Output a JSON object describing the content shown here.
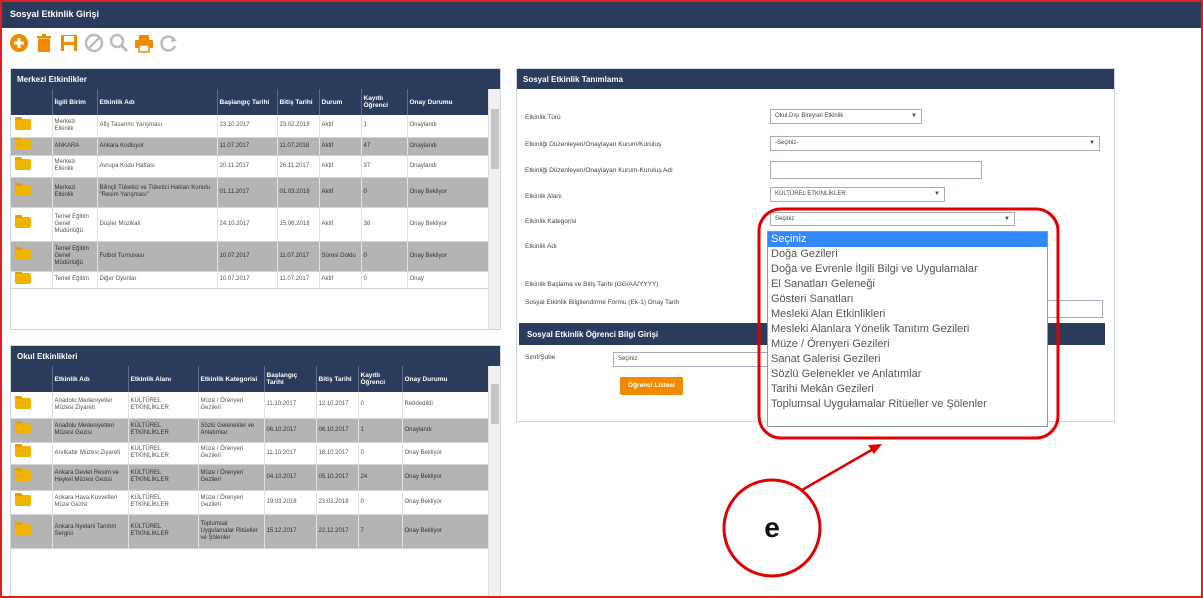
{
  "window_title": "Sosyal Etkinlik Girişi",
  "toolbar": {
    "icons": [
      "add-icon",
      "delete-icon",
      "save-icon",
      "cancel-icon",
      "search-icon",
      "print-icon",
      "refresh-icon"
    ]
  },
  "merkezi": {
    "title": "Merkezi Etkinlikler",
    "columns": [
      "",
      "İlgili Birim",
      "Etkinlik Adı",
      "Başlangıç Tarihi",
      "Bitiş Tarihi",
      "Durum",
      "Kayıtlı Öğrenci",
      "Onay Durumu"
    ],
    "rows": [
      [
        "Merkezi Etkinlik",
        "Afiş Tasarımı Yarışması",
        "23.10.2017",
        "23.02.2018",
        "Aktif",
        "1",
        "Onaylandı"
      ],
      [
        "ANKARA",
        "Ankara Kodluyor",
        "11.07.2017",
        "11.07.2018",
        "Aktif",
        "47",
        "Onaylandı"
      ],
      [
        "Merkezi Etkinlik",
        "Avrupa Kodu Haftası",
        "20.11.2017",
        "26.11.2017",
        "Aktif",
        "37",
        "Onaylandı"
      ],
      [
        "Merkezi Etkinlik",
        "Bilinçli Tüketici ve Tüketici Hakları Konulu \"Resim Yarışması\"",
        "01.11.2017",
        "01.03.2018",
        "Aktif",
        "0",
        "Onay Bekliyor"
      ],
      [
        "Temel Eğitim Genel Müdürlüğü",
        "Düşler Müzikali",
        "24.10.2017",
        "15.06.2018",
        "Aktif",
        "38",
        "Onay Bekliyor"
      ],
      [
        "Temel Eğitim Genel Müdürlüğü",
        "Futbol Turnuvası",
        "10.07.2017",
        "11.07.2017",
        "Süresi Doldu",
        "0",
        "Onay Bekliyor"
      ],
      [
        "Temel Eğitim",
        "Diğer Oyunlar",
        "10.07.2017",
        "11.07.2017",
        "Aktif",
        "0",
        "Onay"
      ]
    ]
  },
  "okul": {
    "title": "Okul Etkinlikleri",
    "columns": [
      "",
      "Etkinlik Adı",
      "Etkinlik Alanı",
      "Etkinlik Kategorisi",
      "Başlangıç Tarihi",
      "Bitiş Tarihi",
      "Kayıtlı Öğrenci",
      "Onay Durumu"
    ],
    "rows": [
      [
        "Anadolu Medeniyetler Müzesi Ziyareti",
        "KÜLTÜREL ETKİNLİKLER",
        "Müze / Örenyeri Gezileri",
        "11.10.2017",
        "12.10.2017",
        "0",
        "Reddedildi"
      ],
      [
        "Anadolu Medeniyetleri Müzesi Gezisi",
        "KÜLTÜREL ETKİNLİKLER",
        "Sözlü Gelenekler ve Anlatımlar",
        "06.10.2017",
        "06.10.2017",
        "1",
        "Onaylandı"
      ],
      [
        "Anıtkabir Müzesi Ziyareti",
        "KÜLTÜREL ETKİNLİKLER",
        "Müze / Örenyeri Gezileri",
        "11.10.2017",
        "18.10.2017",
        "0",
        "Onay Bekliyor"
      ],
      [
        "Ankara Devlet Resim ve Heykel Müzesi Gezisi",
        "KÜLTÜREL ETKİNLİKLER",
        "Müze / Örenyeri Gezileri",
        "04.10.2017",
        "05.10.2017",
        "24",
        "Onay Bekliyor"
      ],
      [
        "Ankara Hava Kuvvetleri Müze Gezisi",
        "KÜLTÜREL ETKİNLİKLER",
        "Müze / Örenyeri Gezileri",
        "19.03.2018",
        "23.03.2018",
        "0",
        "Onay Bekliyor"
      ],
      [
        "Ankara Nyelani Tanıtım Sergisi",
        "KÜLTÜREL ETKİNLİKLER",
        "Toplumsal Uygulamalar Ritüeller ve Şölenler",
        "15.12.2017",
        "22.12.2017",
        "7",
        "Onay Bekliyor"
      ]
    ]
  },
  "form": {
    "title": "Sosyal Etkinlik Tanımlama",
    "etkinlik_turu_label": "Etkinlik Türü",
    "etkinlik_turu_value": "Okul Dışı Bireysel Etkinlik",
    "kurum_label": "Etkinliği Düzenleyen/Onaylayan Kurum/Kuruluş",
    "kurum_value": "-Seçiniz-",
    "kurum_adi_label": "Etkinliği Düzenleyen/Onaylayan Kurum-Kuruluş Adı",
    "kurum_adi_value": "",
    "alan_label": "Etkinlik Alanı",
    "alan_value": "KÜLTÜREL ETKİNLİKLER",
    "kategori_label": "Etkinlik Kategorisi",
    "kategori_value": "Seçiniz",
    "ad_label": "Etkinlik Adı",
    "tarih_label": "Etkinlik Başlama ve Bitiş Tarihi (GG/AA/YYYY)",
    "form_label": "Sosyal Etkinlik Bilgilendirme Formu (Ek-1) Onay Tarih",
    "ogrenci_title": "Sosyal Etkinlik Öğrenci Bilgi Girişi",
    "sube_label": "Sınıf/Şube",
    "sube_value": "Seçiniz",
    "ogrenci_button": "Öğrenci Listesi"
  },
  "dropdown": {
    "selected": "Seçiniz",
    "options": [
      "Seçiniz",
      "Doğa Gezileri",
      "Doğa ve Evrenle İlgili Bilgi ve Uygulamalar",
      "El Sanatları Geleneği",
      "Gösteri Sanatları",
      "Mesleki Alan Etkinlikleri",
      "Mesleki Alanlara Yönelik Tanıtım Gezileri",
      "Müze / Örenyeri Gezileri",
      "Sanat Galerisi Gezileri",
      "Sözlü Gelenekler ve Anlatımlar",
      "Tarihi Mekân Gezileri",
      "Toplumsal Uygulamalar Ritüeller ve Şölenler"
    ]
  },
  "annotation": {
    "label": "e",
    "color": "#e00000"
  }
}
